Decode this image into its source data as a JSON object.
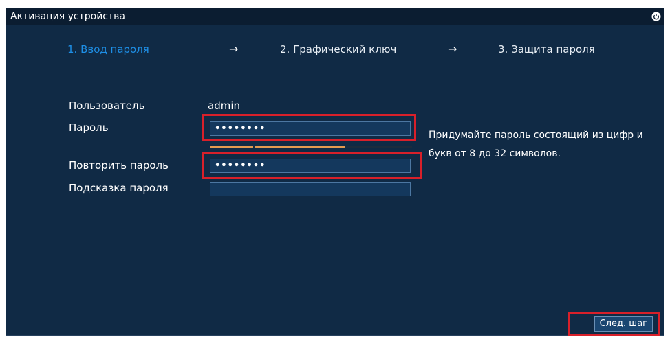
{
  "window": {
    "title": "Активация устройства"
  },
  "steps": [
    {
      "label": "1. Ввод пароля",
      "active": true
    },
    {
      "label": "2. Графический ключ",
      "active": false
    },
    {
      "label": "3. Защита пароля",
      "active": false
    }
  ],
  "arrow_glyph": "→",
  "form": {
    "user_label": "Пользователь",
    "user_value": "admin",
    "password_label": "Пароль",
    "password_value": "••••••••",
    "password_strength_percent": 67,
    "repeat_label": "Повторить пароль",
    "repeat_value": "••••••••",
    "hint_label": "Подсказка пароля",
    "hint_value": ""
  },
  "hint_text": "Придумайте пароль состоящий из цифр и букв от 8 до 32 символов.",
  "footer": {
    "next_label": "След. шаг"
  },
  "colors": {
    "background": "#102a45",
    "titlebar": "#0b1d31",
    "active_step": "#1e8fe6",
    "strength": "#e49a50",
    "highlight": "#d8202a"
  },
  "icons": {
    "power": "power-icon"
  }
}
